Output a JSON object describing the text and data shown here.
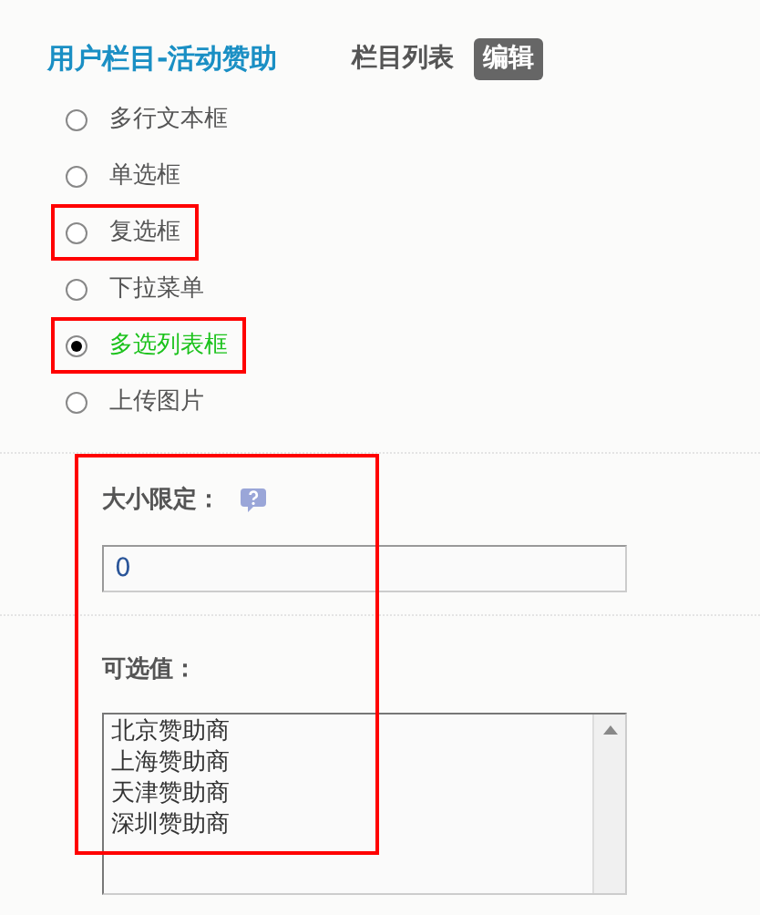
{
  "header": {
    "title": "用户栏目-活动赞助",
    "tabs": [
      {
        "label": "栏目列表",
        "selected": false
      },
      {
        "label": "编辑",
        "selected": true
      }
    ]
  },
  "field_types": [
    {
      "label": "多行文本框",
      "selected": false,
      "highlighted": false
    },
    {
      "label": "单选框",
      "selected": false,
      "highlighted": false
    },
    {
      "label": "复选框",
      "selected": false,
      "highlighted": true
    },
    {
      "label": "下拉菜单",
      "selected": false,
      "highlighted": false
    },
    {
      "label": "多选列表框",
      "selected": true,
      "highlighted": true
    },
    {
      "label": "上传图片",
      "selected": false,
      "highlighted": false
    }
  ],
  "settings": {
    "highlighted": true,
    "size_limit": {
      "label": "大小限定：",
      "value": "0"
    },
    "options": {
      "label": "可选值：",
      "lines": [
        "北京赞助商",
        "上海赞助商",
        "天津赞助商",
        "深圳赞助商"
      ]
    }
  }
}
